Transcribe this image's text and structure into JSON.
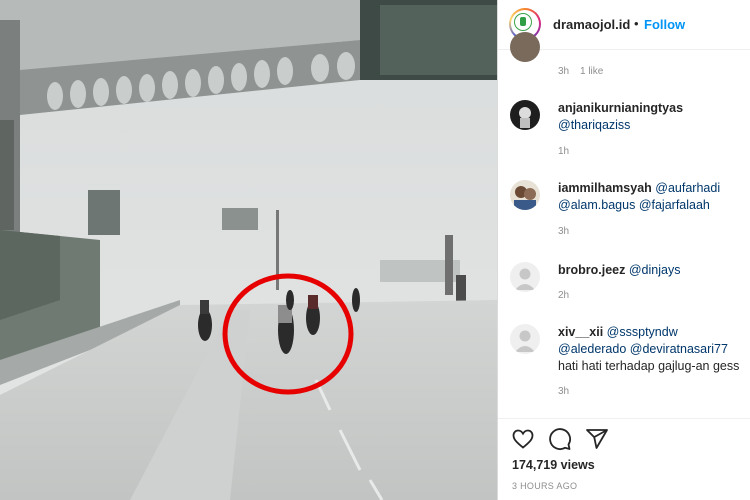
{
  "post": {
    "username": "dramaojol.id",
    "separator": "•",
    "follow_label": "Follow"
  },
  "comments": [
    {
      "meta_time": "3h",
      "meta_likes": "1 like"
    },
    {
      "username": "anjanikurnianingtyas",
      "mentions": [
        "@thariqaziss"
      ],
      "text": "",
      "time": "1h"
    },
    {
      "username": "iammilhamsyah",
      "mentions": [
        "@aufarhadi",
        "@alam.bagus",
        "@fajarfalaah"
      ],
      "text": "",
      "time": "3h"
    },
    {
      "username": "brobro.jeez",
      "mentions": [
        "@dinjays"
      ],
      "text": "",
      "time": "2h"
    },
    {
      "username": "xiv__xii",
      "mentions": [
        "@sssptyndw",
        "@alederado",
        "@deviratnasari77"
      ],
      "text": "hati hati terhadap gajlug-an gess",
      "time": "3h"
    }
  ],
  "stats": {
    "views": "174,719 views",
    "posted_ago": "3 HOURS AGO"
  },
  "icons": {
    "like": "heart-icon",
    "comment": "comment-icon",
    "share": "share-icon"
  },
  "colors": {
    "link": "#0095f6",
    "mention": "#00376b",
    "highlight_circle": "#e60000"
  }
}
